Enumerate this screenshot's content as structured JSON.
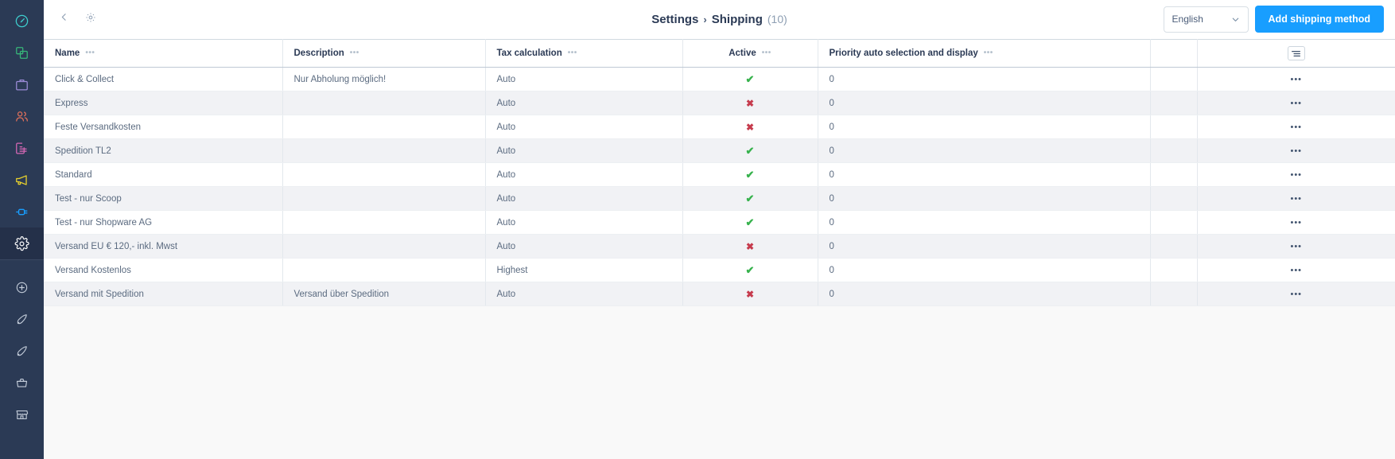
{
  "sidebar": {
    "items": [
      {
        "name": "dashboard",
        "icon": "speedometer-icon",
        "color": "#3ecfcf",
        "active": false
      },
      {
        "name": "catalogues",
        "icon": "layers-icon",
        "color": "#37b679",
        "active": false
      },
      {
        "name": "orders",
        "icon": "briefcase-icon",
        "color": "#9b8bd6",
        "active": false
      },
      {
        "name": "customers",
        "icon": "people-icon",
        "color": "#e0705a",
        "active": false
      },
      {
        "name": "content",
        "icon": "content-document-icon",
        "color": "#d668b5",
        "active": false
      },
      {
        "name": "marketing",
        "icon": "megaphone-icon",
        "color": "#e9d22c",
        "active": false
      },
      {
        "name": "extensions",
        "icon": "plug-icon",
        "color": "#189eff",
        "active": false
      },
      {
        "name": "settings",
        "icon": "gear-icon",
        "color": "#ffffff",
        "active": true
      }
    ],
    "bottom_items": [
      {
        "name": "add",
        "icon": "plus-circle-icon",
        "color": "#c2cbd8"
      },
      {
        "name": "sales-channel-rocket-1",
        "icon": "rocket-icon",
        "color": "#c2cbd8"
      },
      {
        "name": "sales-channel-rocket-2",
        "icon": "rocket-icon",
        "color": "#c2cbd8"
      },
      {
        "name": "storefront-basket",
        "icon": "basket-icon",
        "color": "#c2cbd8"
      },
      {
        "name": "store",
        "icon": "store-icon",
        "color": "#c2cbd8"
      }
    ]
  },
  "header": {
    "back_icon": "chevron-left-icon",
    "settings_icon": "gear-icon",
    "breadcrumb_root": "Settings",
    "breadcrumb_separator": "›",
    "breadcrumb_current": "Shipping",
    "count": "(10)",
    "language_value": "English",
    "language_chevron_icon": "chevron-down-icon",
    "add_button_label": "Add shipping method",
    "accent_color": "#189eff"
  },
  "table": {
    "columns": [
      {
        "label": "Name",
        "align": "left",
        "has_dots": true
      },
      {
        "label": "Description",
        "align": "left",
        "has_dots": true
      },
      {
        "label": "Tax calculation",
        "align": "left",
        "has_dots": true
      },
      {
        "label": "Active",
        "align": "center",
        "has_dots": true
      },
      {
        "label": "Priority auto selection and display",
        "align": "left",
        "has_dots": true
      }
    ],
    "columns_settings_icon": "list-settings-icon",
    "row_menu_glyph": "•••",
    "dots_glyph": "•••",
    "active_yes_glyph": "✔",
    "active_no_glyph": "✖",
    "yes_color": "#37b24d",
    "no_color": "#c63b4d",
    "rows": [
      {
        "name": "Click & Collect",
        "description": "Nur Abholung möglich!",
        "tax": "Auto",
        "active": true,
        "priority": "0"
      },
      {
        "name": "Express",
        "description": "",
        "tax": "Auto",
        "active": false,
        "priority": "0"
      },
      {
        "name": "Feste Versandkosten",
        "description": "",
        "tax": "Auto",
        "active": false,
        "priority": "0"
      },
      {
        "name": "Spedition TL2",
        "description": "",
        "tax": "Auto",
        "active": true,
        "priority": "0"
      },
      {
        "name": "Standard",
        "description": "",
        "tax": "Auto",
        "active": true,
        "priority": "0"
      },
      {
        "name": "Test - nur Scoop",
        "description": "",
        "tax": "Auto",
        "active": true,
        "priority": "0"
      },
      {
        "name": "Test - nur Shopware AG",
        "description": "",
        "tax": "Auto",
        "active": true,
        "priority": "0"
      },
      {
        "name": "Versand EU € 120,- inkl. Mwst",
        "description": "",
        "tax": "Auto",
        "active": false,
        "priority": "0"
      },
      {
        "name": "Versand Kostenlos",
        "description": "",
        "tax": "Highest",
        "active": true,
        "priority": "0"
      },
      {
        "name": "Versand mit Spedition",
        "description": "Versand über Spedition",
        "tax": "Auto",
        "active": false,
        "priority": "0"
      }
    ]
  }
}
